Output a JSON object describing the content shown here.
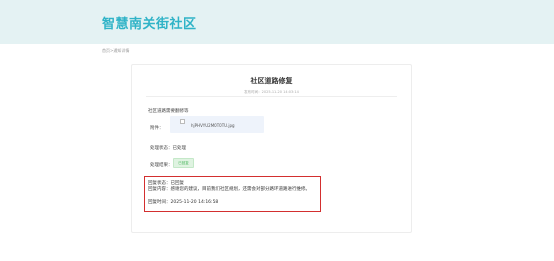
{
  "header": {
    "site_title": "智慧南关街社区"
  },
  "breadcrumb": "首页>通知详情",
  "detail": {
    "title": "社区道路修复",
    "meta": "发布时间：2025-11-20 14:03:14",
    "description": "社区道路需要翻修等",
    "attachment": {
      "label": "附件：",
      "filename": "hjPHVYU2M0T0TU.jpg"
    },
    "status": "处理状态：已处理",
    "result": {
      "label": "处理结果：",
      "badge": "已回复"
    }
  },
  "reply": {
    "status": "回复状态：已回复",
    "content": "回复内容：感谢您的建议，目前我们社区规划，还需会对部分路环道路进行维修。",
    "time": "回复时间：2025-11-20 14:16:58"
  },
  "colors": {
    "accent": "#2fb3c7",
    "header_bg": "#e4f2f3",
    "highlight_border": "#d32f2f",
    "badge_green": "#46b45a"
  }
}
